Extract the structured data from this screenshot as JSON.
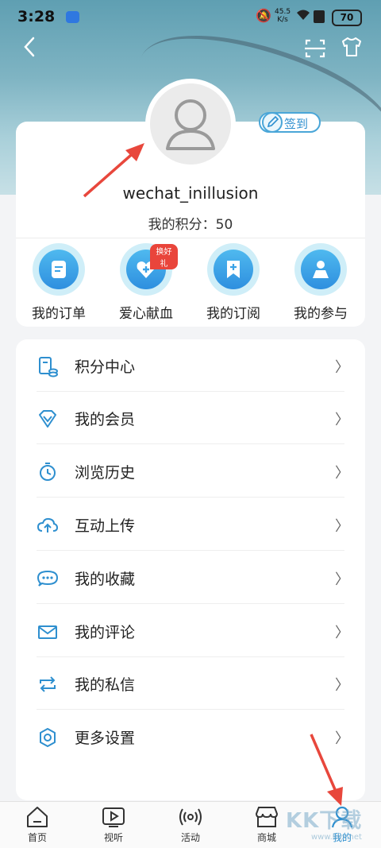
{
  "status_bar": {
    "time": "3:28",
    "net_speed_value": "45.5",
    "net_speed_unit": "K/s",
    "battery": "70"
  },
  "profile": {
    "username": "wechat_inillusion",
    "points_text": "我的积分：50",
    "checkin_label": "签到"
  },
  "quick_actions": [
    {
      "label": "我的订单",
      "icon": "document-icon"
    },
    {
      "label": "爱心献血",
      "icon": "heart-plus-icon",
      "tag": "换好礼"
    },
    {
      "label": "我的订阅",
      "icon": "bookmark-icon"
    },
    {
      "label": "我的参与",
      "icon": "person-icon"
    }
  ],
  "menu": [
    {
      "label": "积分中心",
      "icon": "points-ledger-icon"
    },
    {
      "label": "我的会员",
      "icon": "diamond-icon"
    },
    {
      "label": "浏览历史",
      "icon": "clock-icon"
    },
    {
      "label": "互动上传",
      "icon": "cloud-upload-icon"
    },
    {
      "label": "我的收藏",
      "icon": "chat-bubble-icon"
    },
    {
      "label": "我的评论",
      "icon": "mail-icon"
    },
    {
      "label": "我的私信",
      "icon": "repeat-icon"
    },
    {
      "label": "更多设置",
      "icon": "settings-icon"
    }
  ],
  "tabs": [
    {
      "label": "首页",
      "icon": "home-icon"
    },
    {
      "label": "视听",
      "icon": "play-icon"
    },
    {
      "label": "活动",
      "icon": "broadcast-icon"
    },
    {
      "label": "商城",
      "icon": "store-icon"
    },
    {
      "label": "我的",
      "icon": "user-icon",
      "active": true
    }
  ],
  "colors": {
    "accent": "#2e8fcf",
    "tag_red": "#e9453b",
    "annotation_arrow": "#e8473c"
  },
  "watermark": {
    "brand": "KK下载",
    "url": "www.kkx.net"
  }
}
